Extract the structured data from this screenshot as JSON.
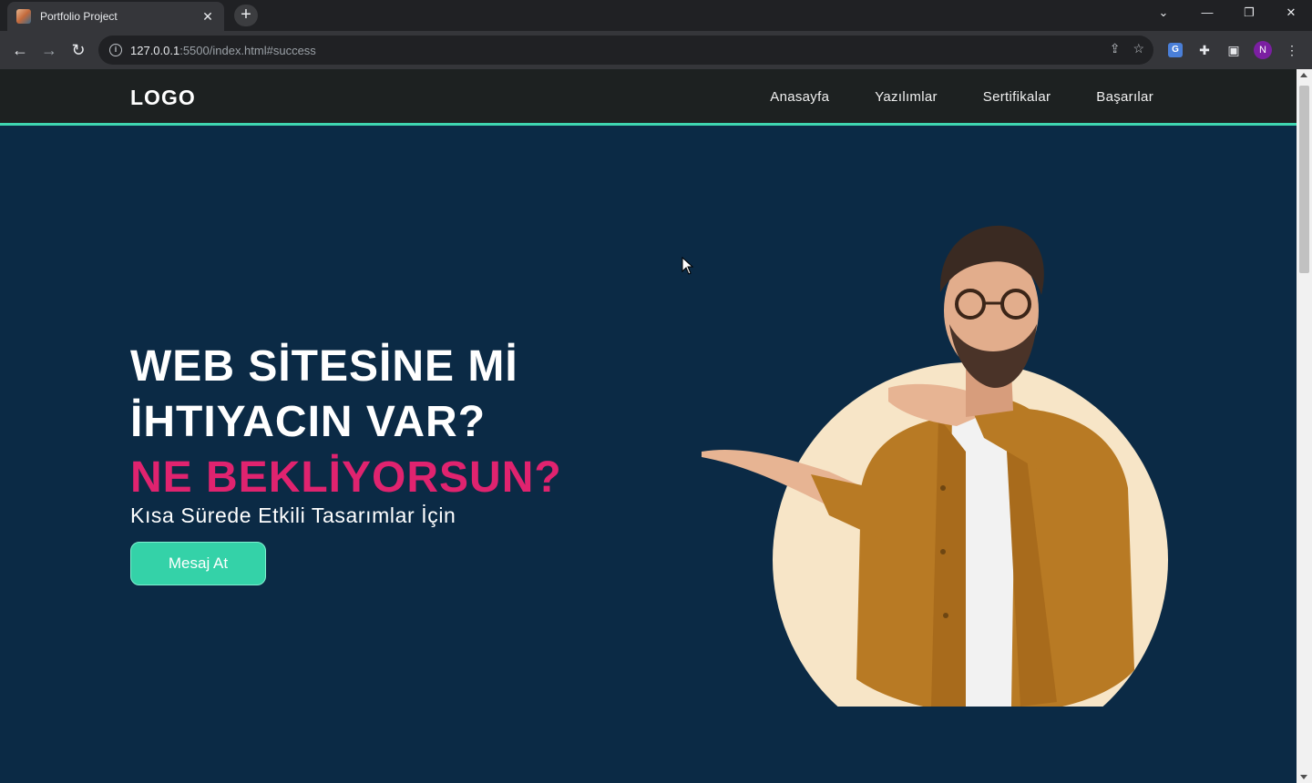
{
  "browser": {
    "tab_title": "Portfolio Project",
    "tab_close_icon": "close-icon",
    "new_tab_icon": "plus-icon",
    "url_host": "127.0.0.1",
    "url_rest": ":5500/index.html#success",
    "profile_initial": "N"
  },
  "site": {
    "logo": "LOGO",
    "nav": [
      "Anasayfa",
      "Yazılımlar",
      "Sertifikalar",
      "Başarılar"
    ],
    "accent_color": "#3fd6b0",
    "highlight_color": "#e0236f",
    "background_color": "#0b2a45"
  },
  "hero": {
    "line1": "WEB SİTESİNE Mİ",
    "line2": "İHTIYACIN VAR?",
    "line3": "NE BEKLİYORSUN?",
    "subtitle": "Kısa Sürede Etkili Tasarımlar İçin",
    "cta": "Mesaj At"
  }
}
